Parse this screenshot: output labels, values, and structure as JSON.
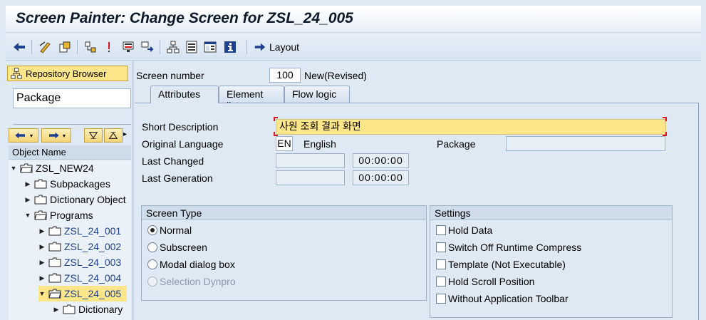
{
  "title": "Screen Painter: Change Screen for ZSL_24_005",
  "toolbar": {
    "icons": [
      "back-icon",
      "other-object-icon",
      "display-change-icon",
      "activate-icon",
      "check-icon",
      "where-used-icon",
      "navigation-window-icon",
      "object-list-icon",
      "fullscreen-icon",
      "hierarchy-icon",
      "layout-icon",
      "info-icon"
    ],
    "layout_label": "Layout"
  },
  "left": {
    "repository_browser": "Repository Browser",
    "package_field": "Package",
    "object_name_header": "Object Name",
    "tree": [
      {
        "label": "ZSL_NEW24",
        "expanded": true,
        "level": 0,
        "blue": false,
        "selected": false
      },
      {
        "label": "Subpackages",
        "expanded": false,
        "level": 1,
        "blue": false,
        "selected": false
      },
      {
        "label": "Dictionary Object",
        "expanded": false,
        "level": 1,
        "blue": false,
        "selected": false
      },
      {
        "label": "Programs",
        "expanded": true,
        "level": 1,
        "blue": false,
        "selected": false
      },
      {
        "label": "ZSL_24_001",
        "expanded": false,
        "level": 2,
        "blue": true,
        "selected": false
      },
      {
        "label": "ZSL_24_002",
        "expanded": false,
        "level": 2,
        "blue": true,
        "selected": false
      },
      {
        "label": "ZSL_24_003",
        "expanded": false,
        "level": 2,
        "blue": true,
        "selected": false
      },
      {
        "label": "ZSL_24_004",
        "expanded": false,
        "level": 2,
        "blue": true,
        "selected": false
      },
      {
        "label": "ZSL_24_005",
        "expanded": true,
        "level": 2,
        "blue": true,
        "selected": true
      },
      {
        "label": "Dictionary",
        "expanded": false,
        "level": 3,
        "blue": false,
        "selected": false
      }
    ]
  },
  "main": {
    "screen_number_label": "Screen number",
    "screen_number": "100",
    "screen_status": "New(Revised)",
    "tabs": [
      "Attributes",
      "Element list",
      "Flow logic"
    ],
    "short_description_label": "Short Description",
    "short_description": "사원 조회 결과 화면",
    "original_language_label": "Original Language",
    "language_code": "EN",
    "language_name": "English",
    "package_label": "Package",
    "package_value": "",
    "last_changed_label": "Last Changed",
    "last_changed_date": "",
    "last_changed_time": "00:00:00",
    "last_generation_label": "Last Generation",
    "last_generation_date": "",
    "last_generation_time": "00:00:00",
    "screen_type": {
      "header": "Screen Type",
      "options": [
        "Normal",
        "Subscreen",
        "Modal dialog box",
        "Selection Dynpro"
      ],
      "selected": "Normal"
    },
    "settings": {
      "header": "Settings",
      "options": [
        "Hold Data",
        "Switch Off Runtime Compress",
        "Template (Not Executable)",
        "Hold Scroll Position",
        "Without Application Toolbar"
      ]
    }
  }
}
